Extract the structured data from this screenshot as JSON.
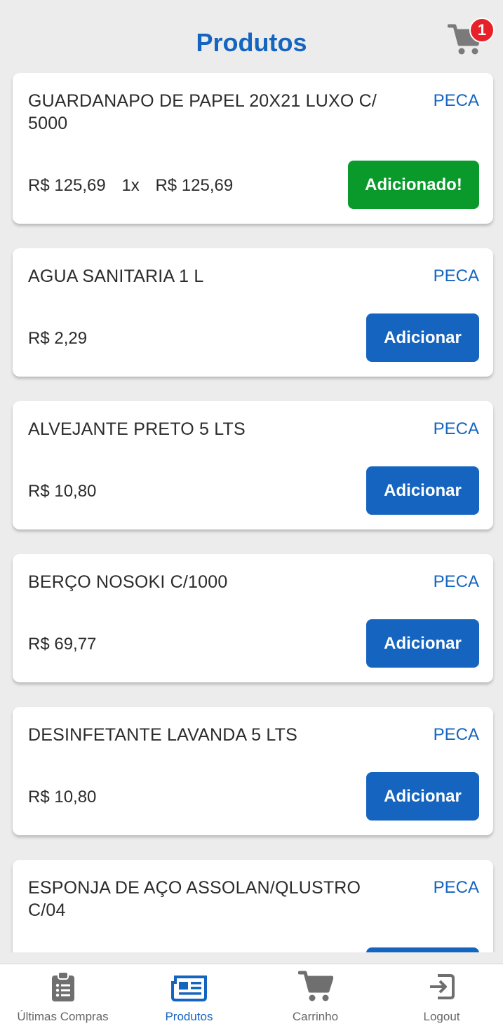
{
  "header": {
    "title": "Produtos",
    "cart_badge": "1"
  },
  "products": [
    {
      "name": "GUARDANAPO DE PAPEL 20X21 LUXO C/ 5000",
      "unit": "PECA",
      "price": "R$ 125,69",
      "qty": "1x",
      "total": "R$ 125,69",
      "button": "Adicionado!"
    },
    {
      "name": "AGUA SANITARIA 1 L",
      "unit": "PECA",
      "price": "R$ 2,29",
      "button": "Adicionar"
    },
    {
      "name": "ALVEJANTE PRETO 5 LTS",
      "unit": "PECA",
      "price": "R$ 10,80",
      "button": "Adicionar"
    },
    {
      "name": "BERÇO NOSOKI C/1000",
      "unit": "PECA",
      "price": "R$ 69,77",
      "button": "Adicionar"
    },
    {
      "name": "DESINFETANTE LAVANDA 5 LTS",
      "unit": "PECA",
      "price": "R$ 10,80",
      "button": "Adicionar"
    },
    {
      "name": "ESPONJA DE AÇO ASSOLAN/QLUSTRO C/04",
      "unit": "PECA"
    }
  ],
  "nav": {
    "items": [
      {
        "label": "Últimas Compras",
        "icon": "clipboard-list-icon"
      },
      {
        "label": "Produtos",
        "icon": "newspaper-icon",
        "active": true
      },
      {
        "label": "Carrinho",
        "icon": "cart-icon"
      },
      {
        "label": "Logout",
        "icon": "logout-icon"
      }
    ]
  },
  "colors": {
    "primary": "#1565c0",
    "success": "#0a9a2c",
    "badge": "#e8202a",
    "background": "#ececec"
  }
}
